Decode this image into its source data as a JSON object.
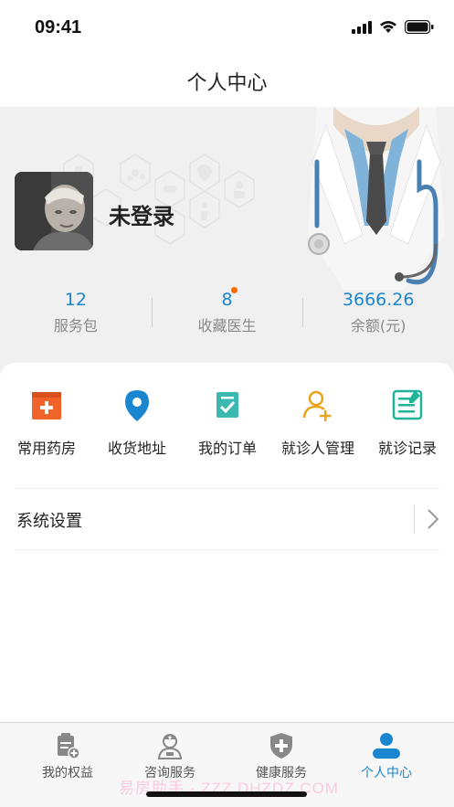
{
  "status_bar": {
    "time": "09:41"
  },
  "nav": {
    "title": "个人中心"
  },
  "profile": {
    "login_status": "未登录"
  },
  "stats": [
    {
      "value": "12",
      "label": "服务包"
    },
    {
      "value": "8",
      "label": "收藏医生"
    },
    {
      "value": "3666.26",
      "label": "余额(元)"
    }
  ],
  "quick_actions": [
    {
      "label": "常用药房",
      "icon": "pharmacy-icon",
      "color": "#f0642a"
    },
    {
      "label": "收货地址",
      "icon": "location-pin-icon",
      "color": "#1a86d0"
    },
    {
      "label": "我的订单",
      "icon": "order-check-icon",
      "color": "#3bb8b0"
    },
    {
      "label": "就诊人管理",
      "icon": "add-patient-icon",
      "color": "#e8a51c"
    },
    {
      "label": "就诊记录",
      "icon": "record-edit-icon",
      "color": "#1fb39a"
    }
  ],
  "settings": {
    "label": "系统设置"
  },
  "tabbar": [
    {
      "label": "我的权益",
      "icon": "benefits-icon"
    },
    {
      "label": "咨询服务",
      "icon": "doctor-consult-icon"
    },
    {
      "label": "健康服务",
      "icon": "health-shield-icon"
    },
    {
      "label": "个人中心",
      "icon": "person-icon",
      "active": true
    }
  ],
  "watermark": "易房助手 · ZZZ.DHZDZ.COM",
  "colors": {
    "accent": "#1a86d0",
    "badge": "#ff6a00"
  }
}
